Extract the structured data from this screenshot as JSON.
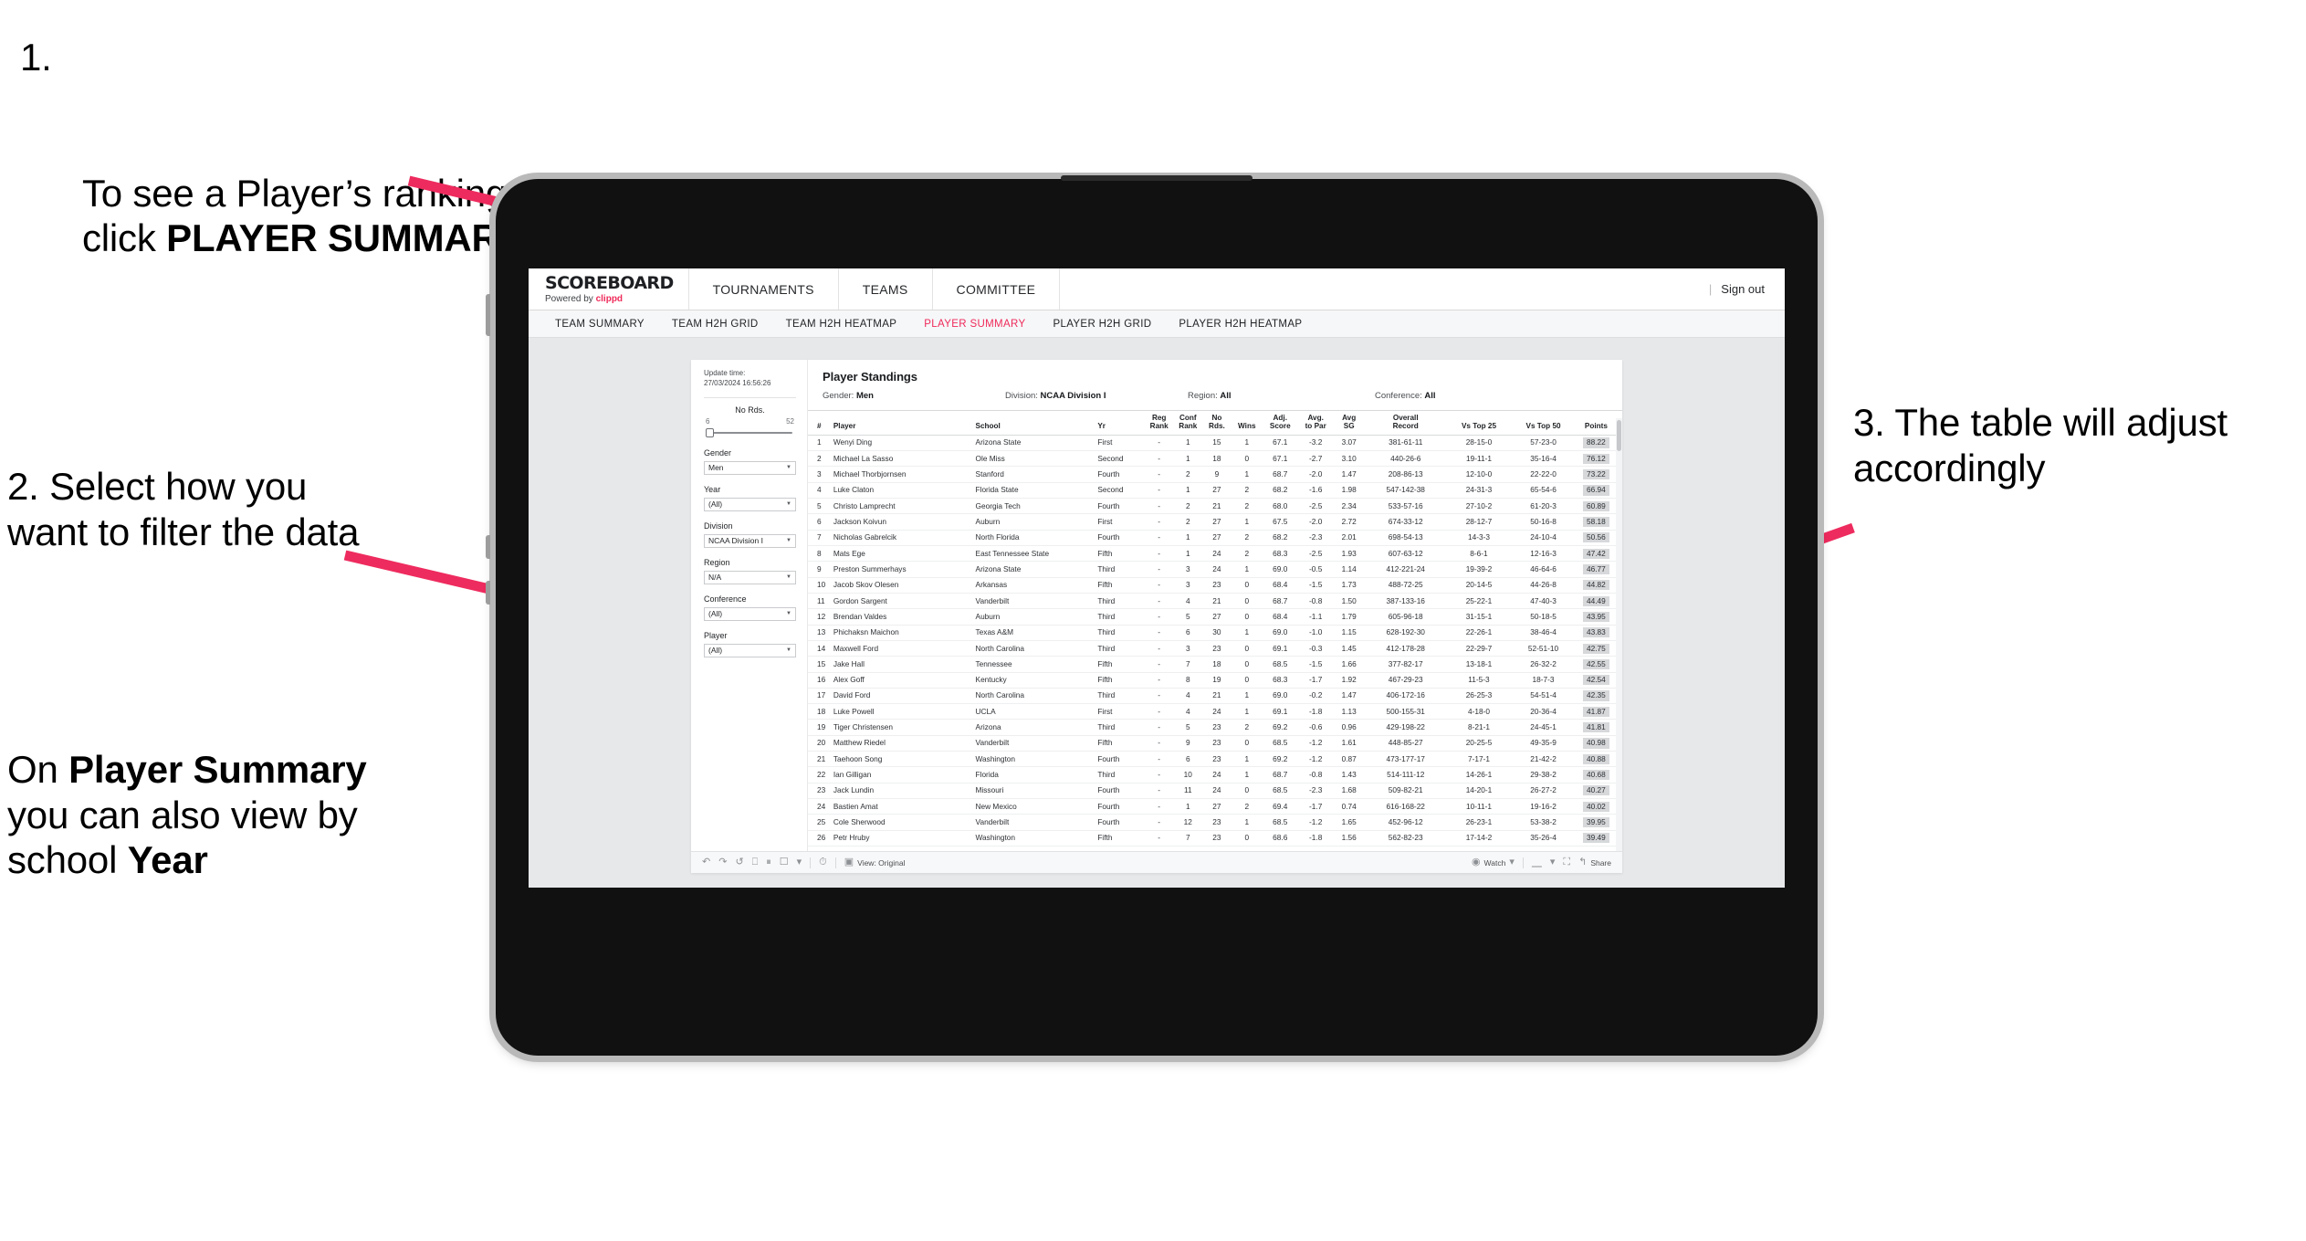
{
  "annotations": {
    "step1": {
      "number": "1.",
      "text_a": "To see a Player’s rankings summary click ",
      "text_b": "PLAYER SUMMARY"
    },
    "step2": "2. Select how you want to filter the data",
    "note": {
      "a": "On ",
      "b": "Player Summary",
      "c": " you can also view by school ",
      "d": "Year"
    },
    "step3": "3. The table will adjust accordingly"
  },
  "app": {
    "brand": {
      "name": "SCOREBOARD",
      "tagline_prefix": "Powered by ",
      "tagline_brand": "clippd"
    },
    "top_nav": [
      "TOURNAMENTS",
      "TEAMS",
      "COMMITTEE"
    ],
    "top_right": {
      "divider": "|",
      "sign_out": "Sign out"
    },
    "sub_nav": [
      {
        "label": "TEAM SUMMARY",
        "active": false
      },
      {
        "label": "TEAM H2H GRID",
        "active": false
      },
      {
        "label": "TEAM H2H HEATMAP",
        "active": false
      },
      {
        "label": "PLAYER SUMMARY",
        "active": true
      },
      {
        "label": "PLAYER H2H GRID",
        "active": false
      },
      {
        "label": "PLAYER H2H HEATMAP",
        "active": false
      }
    ],
    "accent_color": "#ef2a5a"
  },
  "filters": {
    "update_label": "Update time:",
    "update_value": "27/03/2024 16:56:26",
    "slider": {
      "label": "No Rds.",
      "min": "6",
      "max": "52"
    },
    "controls": [
      {
        "label": "Gender",
        "value": "Men"
      },
      {
        "label": "Year",
        "value": "(All)"
      },
      {
        "label": "Division",
        "value": "NCAA Division I"
      },
      {
        "label": "Region",
        "value": "N/A"
      },
      {
        "label": "Conference",
        "value": "(All)"
      },
      {
        "label": "Player",
        "value": "(All)"
      }
    ]
  },
  "viz": {
    "title": "Player Standings",
    "summary": [
      {
        "label": "Gender:",
        "value": "Men"
      },
      {
        "label": "Division:",
        "value": "NCAA Division I"
      },
      {
        "label": "Region:",
        "value": "All"
      },
      {
        "label": "Conference:",
        "value": "All"
      }
    ],
    "columns": [
      {
        "key": "num",
        "l1": "#",
        "l2": ""
      },
      {
        "key": "player",
        "l1": "Player",
        "l2": ""
      },
      {
        "key": "school",
        "l1": "School",
        "l2": ""
      },
      {
        "key": "yr",
        "l1": "Yr",
        "l2": ""
      },
      {
        "key": "reg",
        "l1": "Reg",
        "l2": "Rank"
      },
      {
        "key": "conf",
        "l1": "Conf",
        "l2": "Rank"
      },
      {
        "key": "rds",
        "l1": "No",
        "l2": "Rds."
      },
      {
        "key": "wins",
        "l1": "",
        "l2": "Wins"
      },
      {
        "key": "adj",
        "l1": "Adj.",
        "l2": "Score"
      },
      {
        "key": "par",
        "l1": "Avg.",
        "l2": "to Par"
      },
      {
        "key": "sg",
        "l1": "Avg",
        "l2": "SG"
      },
      {
        "key": "rec",
        "l1": "Overall",
        "l2": "Record"
      },
      {
        "key": "t25",
        "l1": "",
        "l2": "Vs Top 25"
      },
      {
        "key": "t50",
        "l1": "",
        "l2": "Vs Top 50"
      },
      {
        "key": "pts",
        "l1": "",
        "l2": "Points"
      }
    ],
    "rows": [
      [
        "1",
        "Wenyi Ding",
        "Arizona State",
        "First",
        "-",
        "1",
        "15",
        "1",
        "67.1",
        "-3.2",
        "3.07",
        "381-61-11",
        "28-15-0",
        "57-23-0",
        "88.22"
      ],
      [
        "2",
        "Michael La Sasso",
        "Ole Miss",
        "Second",
        "-",
        "1",
        "18",
        "0",
        "67.1",
        "-2.7",
        "3.10",
        "440-26-6",
        "19-11-1",
        "35-16-4",
        "76.12"
      ],
      [
        "3",
        "Michael Thorbjornsen",
        "Stanford",
        "Fourth",
        "-",
        "2",
        "9",
        "1",
        "68.7",
        "-2.0",
        "1.47",
        "208-86-13",
        "12-10-0",
        "22-22-0",
        "73.22"
      ],
      [
        "4",
        "Luke Claton",
        "Florida State",
        "Second",
        "-",
        "1",
        "27",
        "2",
        "68.2",
        "-1.6",
        "1.98",
        "547-142-38",
        "24-31-3",
        "65-54-6",
        "66.94"
      ],
      [
        "5",
        "Christo Lamprecht",
        "Georgia Tech",
        "Fourth",
        "-",
        "2",
        "21",
        "2",
        "68.0",
        "-2.5",
        "2.34",
        "533-57-16",
        "27-10-2",
        "61-20-3",
        "60.89"
      ],
      [
        "6",
        "Jackson Koivun",
        "Auburn",
        "First",
        "-",
        "2",
        "27",
        "1",
        "67.5",
        "-2.0",
        "2.72",
        "674-33-12",
        "28-12-7",
        "50-16-8",
        "58.18"
      ],
      [
        "7",
        "Nicholas Gabrelcik",
        "North Florida",
        "Fourth",
        "-",
        "1",
        "27",
        "2",
        "68.2",
        "-2.3",
        "2.01",
        "698-54-13",
        "14-3-3",
        "24-10-4",
        "50.56"
      ],
      [
        "8",
        "Mats Ege",
        "East Tennessee State",
        "Fifth",
        "-",
        "1",
        "24",
        "2",
        "68.3",
        "-2.5",
        "1.93",
        "607-63-12",
        "8-6-1",
        "12-16-3",
        "47.42"
      ],
      [
        "9",
        "Preston Summerhays",
        "Arizona State",
        "Third",
        "-",
        "3",
        "24",
        "1",
        "69.0",
        "-0.5",
        "1.14",
        "412-221-24",
        "19-39-2",
        "46-64-6",
        "46.77"
      ],
      [
        "10",
        "Jacob Skov Olesen",
        "Arkansas",
        "Fifth",
        "-",
        "3",
        "23",
        "0",
        "68.4",
        "-1.5",
        "1.73",
        "488-72-25",
        "20-14-5",
        "44-26-8",
        "44.82"
      ],
      [
        "11",
        "Gordon Sargent",
        "Vanderbilt",
        "Third",
        "-",
        "4",
        "21",
        "0",
        "68.7",
        "-0.8",
        "1.50",
        "387-133-16",
        "25-22-1",
        "47-40-3",
        "44.49"
      ],
      [
        "12",
        "Brendan Valdes",
        "Auburn",
        "Third",
        "-",
        "5",
        "27",
        "0",
        "68.4",
        "-1.1",
        "1.79",
        "605-96-18",
        "31-15-1",
        "50-18-5",
        "43.95"
      ],
      [
        "13",
        "Phichaksn Maichon",
        "Texas A&M",
        "Third",
        "-",
        "6",
        "30",
        "1",
        "69.0",
        "-1.0",
        "1.15",
        "628-192-30",
        "22-26-1",
        "38-46-4",
        "43.83"
      ],
      [
        "14",
        "Maxwell Ford",
        "North Carolina",
        "Third",
        "-",
        "3",
        "23",
        "0",
        "69.1",
        "-0.3",
        "1.45",
        "412-178-28",
        "22-29-7",
        "52-51-10",
        "42.75"
      ],
      [
        "15",
        "Jake Hall",
        "Tennessee",
        "Fifth",
        "-",
        "7",
        "18",
        "0",
        "68.5",
        "-1.5",
        "1.66",
        "377-82-17",
        "13-18-1",
        "26-32-2",
        "42.55"
      ],
      [
        "16",
        "Alex Goff",
        "Kentucky",
        "Fifth",
        "-",
        "8",
        "19",
        "0",
        "68.3",
        "-1.7",
        "1.92",
        "467-29-23",
        "11-5-3",
        "18-7-3",
        "42.54"
      ],
      [
        "17",
        "David Ford",
        "North Carolina",
        "Third",
        "-",
        "4",
        "21",
        "1",
        "69.0",
        "-0.2",
        "1.47",
        "406-172-16",
        "26-25-3",
        "54-51-4",
        "42.35"
      ],
      [
        "18",
        "Luke Powell",
        "UCLA",
        "First",
        "-",
        "4",
        "24",
        "1",
        "69.1",
        "-1.8",
        "1.13",
        "500-155-31",
        "4-18-0",
        "20-36-4",
        "41.87"
      ],
      [
        "19",
        "Tiger Christensen",
        "Arizona",
        "Third",
        "-",
        "5",
        "23",
        "2",
        "69.2",
        "-0.6",
        "0.96",
        "429-198-22",
        "8-21-1",
        "24-45-1",
        "41.81"
      ],
      [
        "20",
        "Matthew Riedel",
        "Vanderbilt",
        "Fifth",
        "-",
        "9",
        "23",
        "0",
        "68.5",
        "-1.2",
        "1.61",
        "448-85-27",
        "20-25-5",
        "49-35-9",
        "40.98"
      ],
      [
        "21",
        "Taehoon Song",
        "Washington",
        "Fourth",
        "-",
        "6",
        "23",
        "1",
        "69.2",
        "-1.2",
        "0.87",
        "473-177-17",
        "7-17-1",
        "21-42-2",
        "40.88"
      ],
      [
        "22",
        "Ian Gilligan",
        "Florida",
        "Third",
        "-",
        "10",
        "24",
        "1",
        "68.7",
        "-0.8",
        "1.43",
        "514-111-12",
        "14-26-1",
        "29-38-2",
        "40.68"
      ],
      [
        "23",
        "Jack Lundin",
        "Missouri",
        "Fourth",
        "-",
        "11",
        "24",
        "0",
        "68.5",
        "-2.3",
        "1.68",
        "509-82-21",
        "14-20-1",
        "26-27-2",
        "40.27"
      ],
      [
        "24",
        "Bastien Amat",
        "New Mexico",
        "Fourth",
        "-",
        "1",
        "27",
        "2",
        "69.4",
        "-1.7",
        "0.74",
        "616-168-22",
        "10-11-1",
        "19-16-2",
        "40.02"
      ],
      [
        "25",
        "Cole Sherwood",
        "Vanderbilt",
        "Fourth",
        "-",
        "12",
        "23",
        "1",
        "68.5",
        "-1.2",
        "1.65",
        "452-96-12",
        "26-23-1",
        "53-38-2",
        "39.95"
      ],
      [
        "26",
        "Petr Hruby",
        "Washington",
        "Fifth",
        "-",
        "7",
        "23",
        "0",
        "68.6",
        "-1.8",
        "1.56",
        "562-82-23",
        "17-14-2",
        "35-26-4",
        "39.49"
      ]
    ]
  },
  "toolbar": {
    "view_label": "View: Original",
    "watch_label": "Watch",
    "share_label": "Share"
  }
}
